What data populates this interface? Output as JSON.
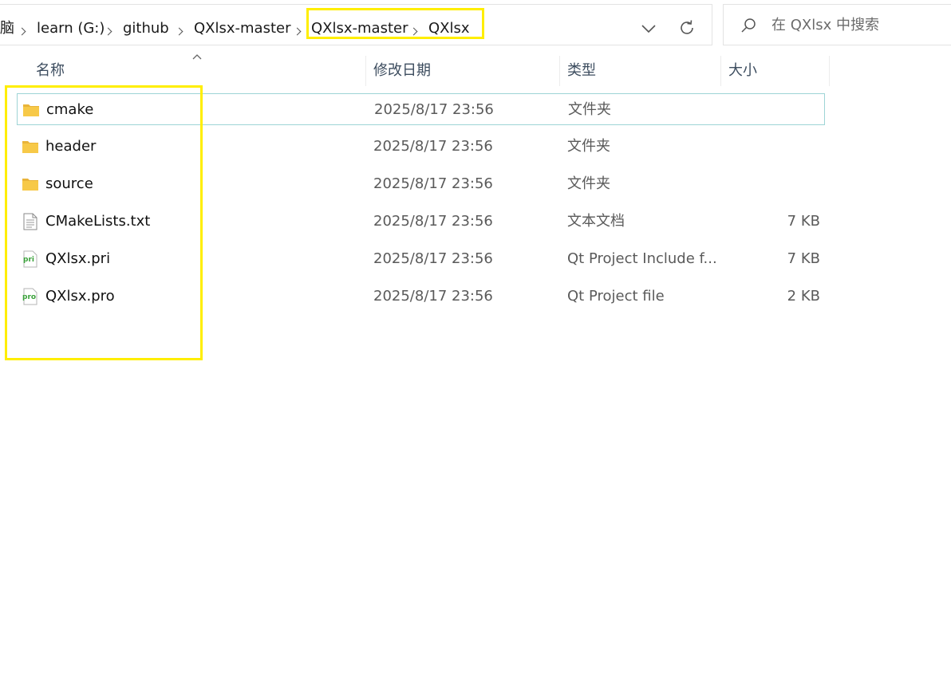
{
  "breadcrumb": {
    "items": [
      "脑",
      "learn (G:)",
      "github",
      "QXlsx-master",
      "QXlsx-master",
      "QXlsx"
    ]
  },
  "search": {
    "placeholder": "在 QXlsx 中搜索"
  },
  "columns": {
    "name": "名称",
    "date": "修改日期",
    "type": "类型",
    "size": "大小"
  },
  "files": [
    {
      "name": "cmake",
      "date": "2025/8/17 23:56",
      "type": "文件夹",
      "size": "",
      "icon": "folder-icon",
      "selected": true
    },
    {
      "name": "header",
      "date": "2025/8/17 23:56",
      "type": "文件夹",
      "size": "",
      "icon": "folder-icon"
    },
    {
      "name": "source",
      "date": "2025/8/17 23:56",
      "type": "文件夹",
      "size": "",
      "icon": "folder-icon"
    },
    {
      "name": "CMakeLists.txt",
      "date": "2025/8/17 23:56",
      "type": "文本文档",
      "size": "7 KB",
      "icon": "text-file-icon"
    },
    {
      "name": "QXlsx.pri",
      "date": "2025/8/17 23:56",
      "type": "Qt Project Include f...",
      "size": "7 KB",
      "icon": "pri-file-icon",
      "badge": "pri"
    },
    {
      "name": "QXlsx.pro",
      "date": "2025/8/17 23:56",
      "type": "Qt Project file",
      "size": "2 KB",
      "icon": "pro-file-icon",
      "badge": "pro"
    }
  ],
  "colors": {
    "highlight": "#ffee00",
    "selection_border": "#9ed4d6",
    "folder": "#f7c948",
    "qt_badge": "#3aa23a"
  }
}
